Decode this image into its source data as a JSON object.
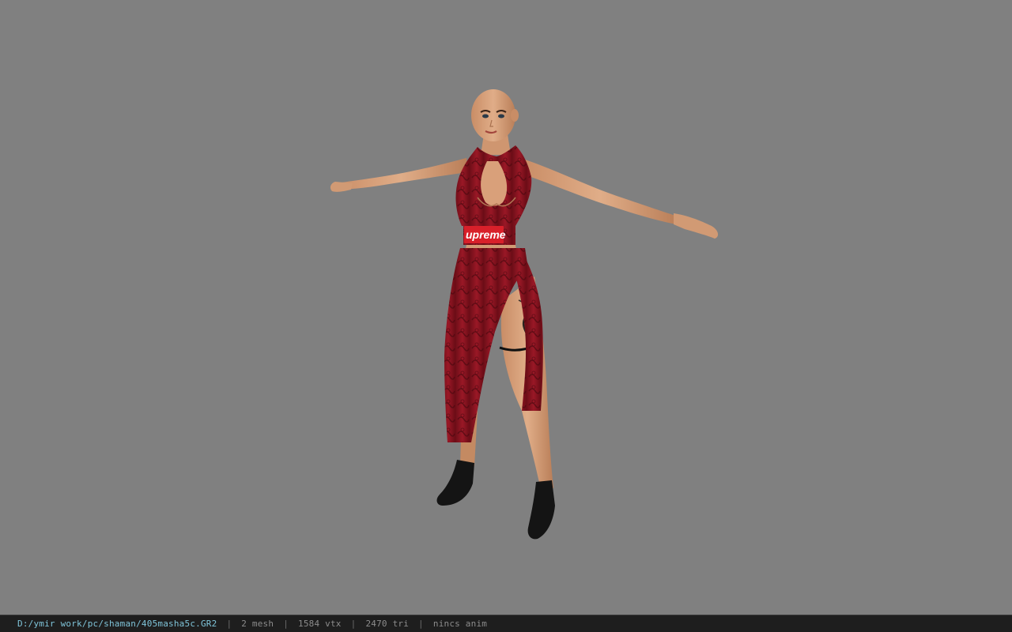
{
  "viewport": {
    "background_color": "#808080",
    "model": {
      "dress_color": "#8f1420",
      "skin_color": "#d9a27a",
      "boot_color": "#141414",
      "logo_text": "upreme",
      "logo_color": "#d8202a"
    }
  },
  "status_bar": {
    "file_path": "D:/ymir work/pc/shaman/405masha5c.GR2",
    "separator": "|",
    "mesh_count": "2 mesh",
    "vertex_count": "1584 vtx",
    "triangle_count": "2470 tri",
    "anim_status": "nincs anim"
  }
}
